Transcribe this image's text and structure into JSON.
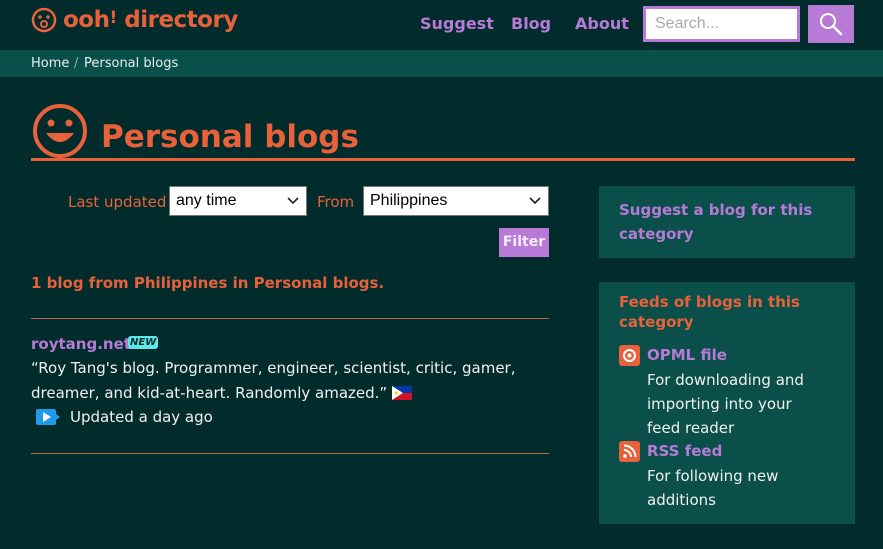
{
  "header": {
    "logo_word": "ooh",
    "logo_bang": "!",
    "logo_tail": " directory",
    "nav": [
      "Suggest",
      "Blog",
      "About"
    ],
    "search_placeholder": "Search..."
  },
  "breadcrumb": {
    "home": "Home",
    "separator": "/",
    "current": "Personal blogs"
  },
  "page": {
    "title": "Personal blogs"
  },
  "filters": {
    "last_updated_label": "Last updated",
    "last_updated_value": "any time",
    "from_label": "From",
    "from_value": "Philippines",
    "filter_button": "Filter"
  },
  "results": {
    "summary": "1 blog from Philippines in Personal blogs.",
    "blogs": [
      {
        "name": "roytang.net",
        "badge": "NEW",
        "description": "“Roy Tang's blog. Programmer, engineer, scientist, critic, gamer, dreamer, and kid-at-heart. Randomly amazed.”",
        "updated": "Updated a day ago"
      }
    ]
  },
  "sidebar": {
    "suggest": "Suggest a blog for this category",
    "feeds_title": "Feeds of blogs in this category",
    "feeds": [
      {
        "name": "OPML file",
        "description": "For downloading and importing into your feed reader",
        "icon": "opml-icon"
      },
      {
        "name": "RSS feed",
        "description": "For following new additions",
        "icon": "rss-icon"
      }
    ]
  },
  "colors": {
    "background": "#022c2c",
    "accent": "#e8613a",
    "link": "#b77ad6",
    "panel": "#0b4f4a"
  }
}
